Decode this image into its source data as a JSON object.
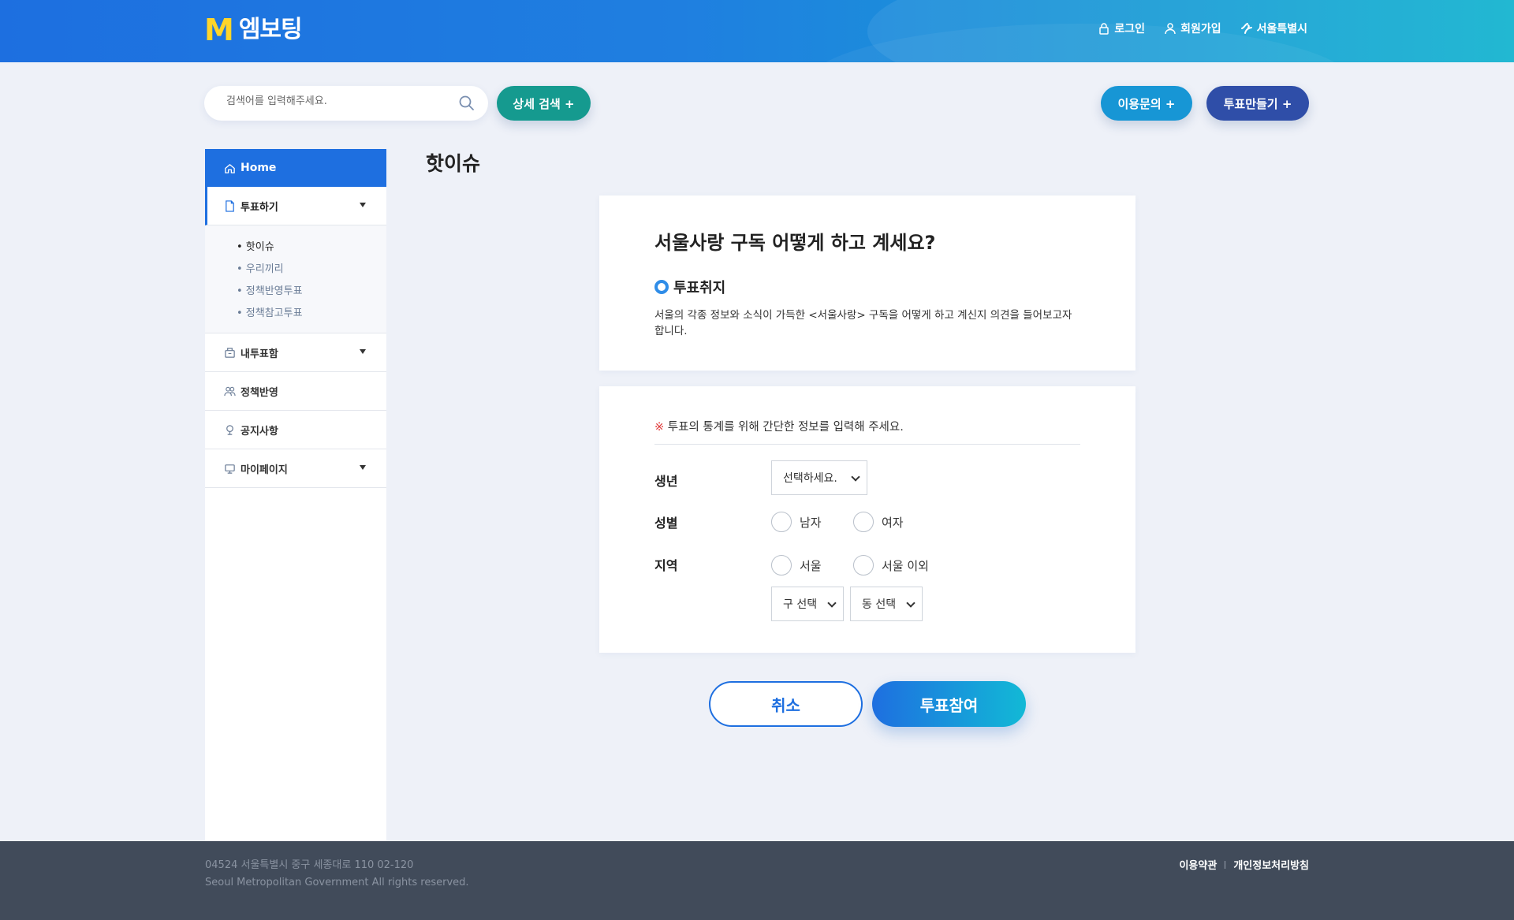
{
  "header": {
    "logo_mark": "M",
    "logo_text": "엠보팅",
    "links": {
      "login": "로그인",
      "signup": "회원가입",
      "seoul": "서울특별시"
    }
  },
  "search": {
    "placeholder": "검색어를 입력해주세요.",
    "detail_button": "상세 검색 +",
    "inquiry_button": "이용문의 +",
    "create_button": "투표만들기 +"
  },
  "sidebar": {
    "home": "Home",
    "items": [
      {
        "label": "투표하기",
        "icon": "document-icon",
        "expandable": true,
        "active": true
      },
      {
        "label": "내투표함",
        "icon": "inbox-icon",
        "expandable": true
      },
      {
        "label": "정책반영",
        "icon": "people-icon",
        "expandable": false
      },
      {
        "label": "공지사항",
        "icon": "megaphone-icon",
        "expandable": false
      },
      {
        "label": "마이페이지",
        "icon": "monitor-icon",
        "expandable": true
      }
    ],
    "subitems": [
      "• 핫이슈",
      "• 우리끼리",
      "• 정책반영투표",
      "• 정책참고투표"
    ]
  },
  "main": {
    "page_title": "핫이슈",
    "question": "서울사랑 구독 어떻게 하고 계세요?",
    "purpose_heading": "투표취지",
    "purpose_text": "서울의 각종 정보와 소식이 가득한 <서울사랑> 구독을 어떻게 하고 계신지 의견을 들어보고자 합니다.",
    "notice_mark": "※",
    "notice_text": " 투표의 통계를 위해 간단한 정보를 입력해 주세요.",
    "form": {
      "birth_label": "생년",
      "birth_select": "선택하세요.",
      "gender_label": "성별",
      "gender_male": "남자",
      "gender_female": "여자",
      "region_label": "지역",
      "region_seoul": "서울",
      "region_other": "서울 이외",
      "gu_select": "구 선택",
      "dong_select": "동 선택"
    },
    "cancel_button": "취소",
    "vote_button": "투표참여"
  },
  "footer": {
    "address": "04524 서울특별시 중구 세종대로 110    02-120",
    "copyright": "Seoul Metropolitan Government All rights reserved.",
    "terms": "이용약관",
    "privacy": "개인정보처리방침"
  },
  "colors": {
    "primary": "#1e6fe0",
    "teal": "#159a8f",
    "sky": "#1796d5",
    "navy": "#2f4ea8",
    "footer_bg": "#414b5a"
  }
}
